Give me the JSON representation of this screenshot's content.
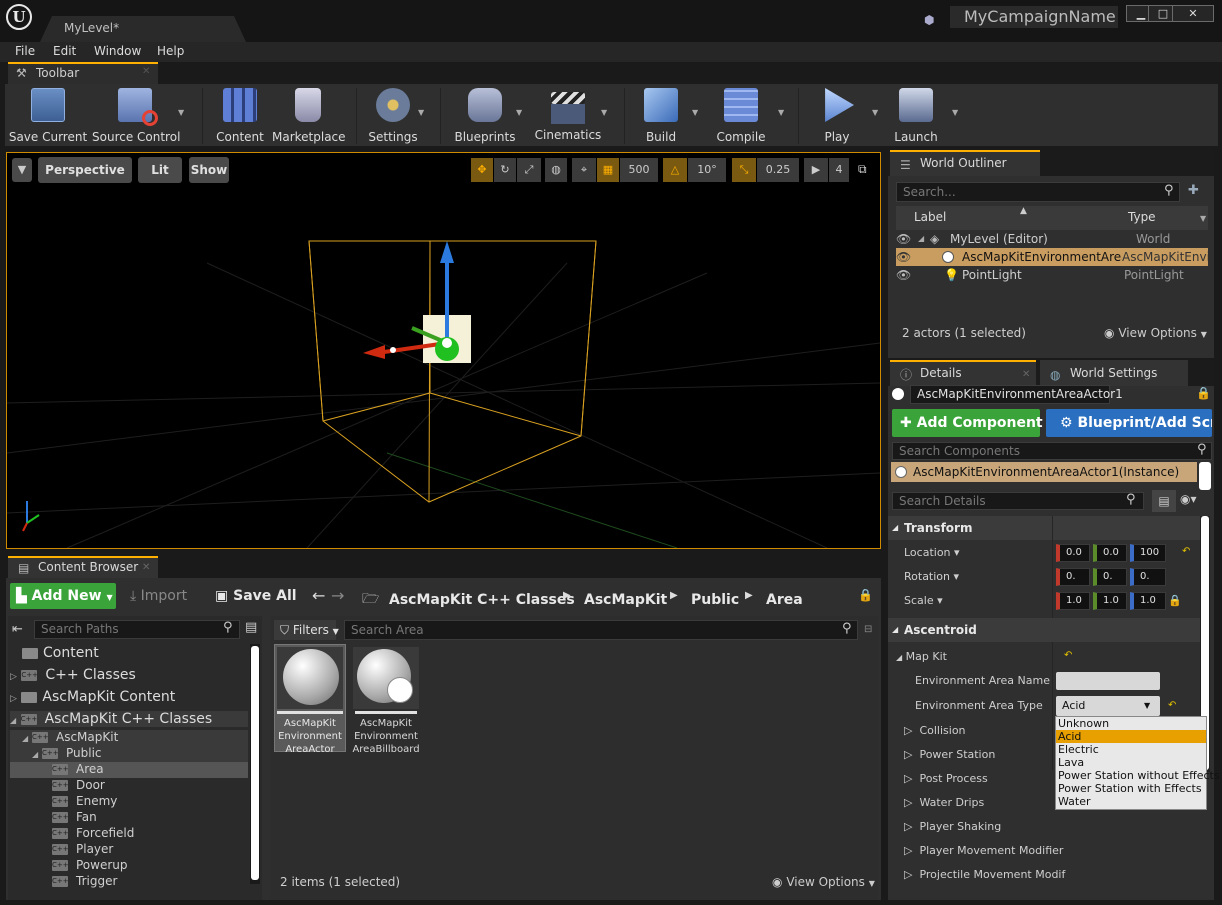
{
  "window": {
    "doc_tab": "MyLevel*",
    "campaign_name": "MyCampaignName",
    "min": "▁",
    "max": "□",
    "close": "✕"
  },
  "menu": [
    "File",
    "Edit",
    "Window",
    "Help"
  ],
  "toolbar_tab": "Toolbar",
  "toolbar": [
    {
      "label": "Save Current",
      "icon": "save-icon",
      "color": "#6a8fc4"
    },
    {
      "label": "Source Control",
      "icon": "source-control-icon",
      "color": "#7a9ad6"
    },
    {
      "label": "Content",
      "icon": "content-icon",
      "color": "#5f7fd6"
    },
    {
      "label": "Marketplace",
      "icon": "marketplace-icon",
      "color": "#a0a0b8"
    },
    {
      "label": "Settings",
      "icon": "settings-icon",
      "color": "#6a7c9a"
    },
    {
      "label": "Blueprints",
      "icon": "blueprints-icon",
      "color": "#8b96b8"
    },
    {
      "label": "Cinematics",
      "icon": "cinematics-icon",
      "color": "#7b88a6"
    },
    {
      "label": "Build",
      "icon": "build-icon",
      "color": "#6a9ad8"
    },
    {
      "label": "Compile",
      "icon": "compile-icon",
      "color": "#6a8ad8"
    },
    {
      "label": "Play",
      "icon": "play-icon",
      "color": "#6c94d8"
    },
    {
      "label": "Launch",
      "icon": "launch-icon",
      "color": "#7a8ab0"
    }
  ],
  "viewport": {
    "perspective": "Perspective",
    "lit": "Lit",
    "show": "Show",
    "grid_snap": "500",
    "rot_snap": "10°",
    "scale_snap": "0.25",
    "cam_speed": "4"
  },
  "outliner": {
    "tab": "World Outliner",
    "search_placeholder": "Search...",
    "col_label": "Label",
    "col_type": "Type",
    "rows": [
      {
        "label": "MyLevel (Editor)",
        "type": "World"
      },
      {
        "label": "AscMapKitEnvironmentAreaA",
        "type": "AscMapKitEnvir"
      },
      {
        "label": "PointLight",
        "type": "PointLight"
      }
    ],
    "status": "2 actors (1 selected)",
    "view_options": "View Options"
  },
  "details": {
    "tab": "Details",
    "tab2": "World Settings",
    "actor_name": "AscMapKitEnvironmentAreaActor1",
    "add_component": "Add Component",
    "blueprint": "Blueprint/Add Scr",
    "search_components": "Search Components",
    "component": "AscMapKitEnvironmentAreaActor1(Instance)",
    "search_details": "Search Details",
    "transform": "Transform",
    "location": "Location",
    "rotation": "Rotation",
    "scale": "Scale",
    "loc": [
      "0.0",
      "0.0",
      "100"
    ],
    "rot": [
      "0.",
      "0.",
      "0."
    ],
    "scl": [
      "1.0",
      "1.0",
      "1.0"
    ],
    "ascentroid": "Ascentroid",
    "map_kit": "Map Kit",
    "env_area_name": "Environment Area Name",
    "env_area_type": "Environment Area Type",
    "env_area_type_value": "Acid",
    "categories": [
      "Collision",
      "Power Station",
      "Post Process",
      "Water Drips",
      "Player Shaking",
      "Player Movement Modifier",
      "Projectile Movement Modif"
    ],
    "dropdown": [
      "Unknown",
      "Acid",
      "Electric",
      "Lava",
      "Power Station without Effects",
      "Power Station with Effects",
      "Water"
    ]
  },
  "content_browser": {
    "tab": "Content Browser",
    "add_new": "Add New",
    "import": "Import",
    "save_all": "Save All",
    "path": [
      "AscMapKit C++ Classes",
      "AscMapKit",
      "Public",
      "Area"
    ],
    "search_paths": "Search Paths",
    "filters": "Filters",
    "search_area": "Search Area",
    "tree_top": [
      "Content",
      "C++ Classes",
      "AscMapKit Content",
      "AscMapKit C++ Classes"
    ],
    "tree_sub": [
      "AscMapKit",
      "Public"
    ],
    "tree_leaf": [
      "Area",
      "Door",
      "Enemy",
      "Fan",
      "Forcefield",
      "Player",
      "Powerup",
      "Trigger"
    ],
    "assets": [
      {
        "line1": "AscMapKit",
        "line2": "Environment",
        "line3": "AreaActor"
      },
      {
        "line1": "AscMapKit",
        "line2": "Environment",
        "line3": "AreaBillboard"
      }
    ],
    "status": "2 items (1 selected)",
    "view_options": "View Options"
  }
}
